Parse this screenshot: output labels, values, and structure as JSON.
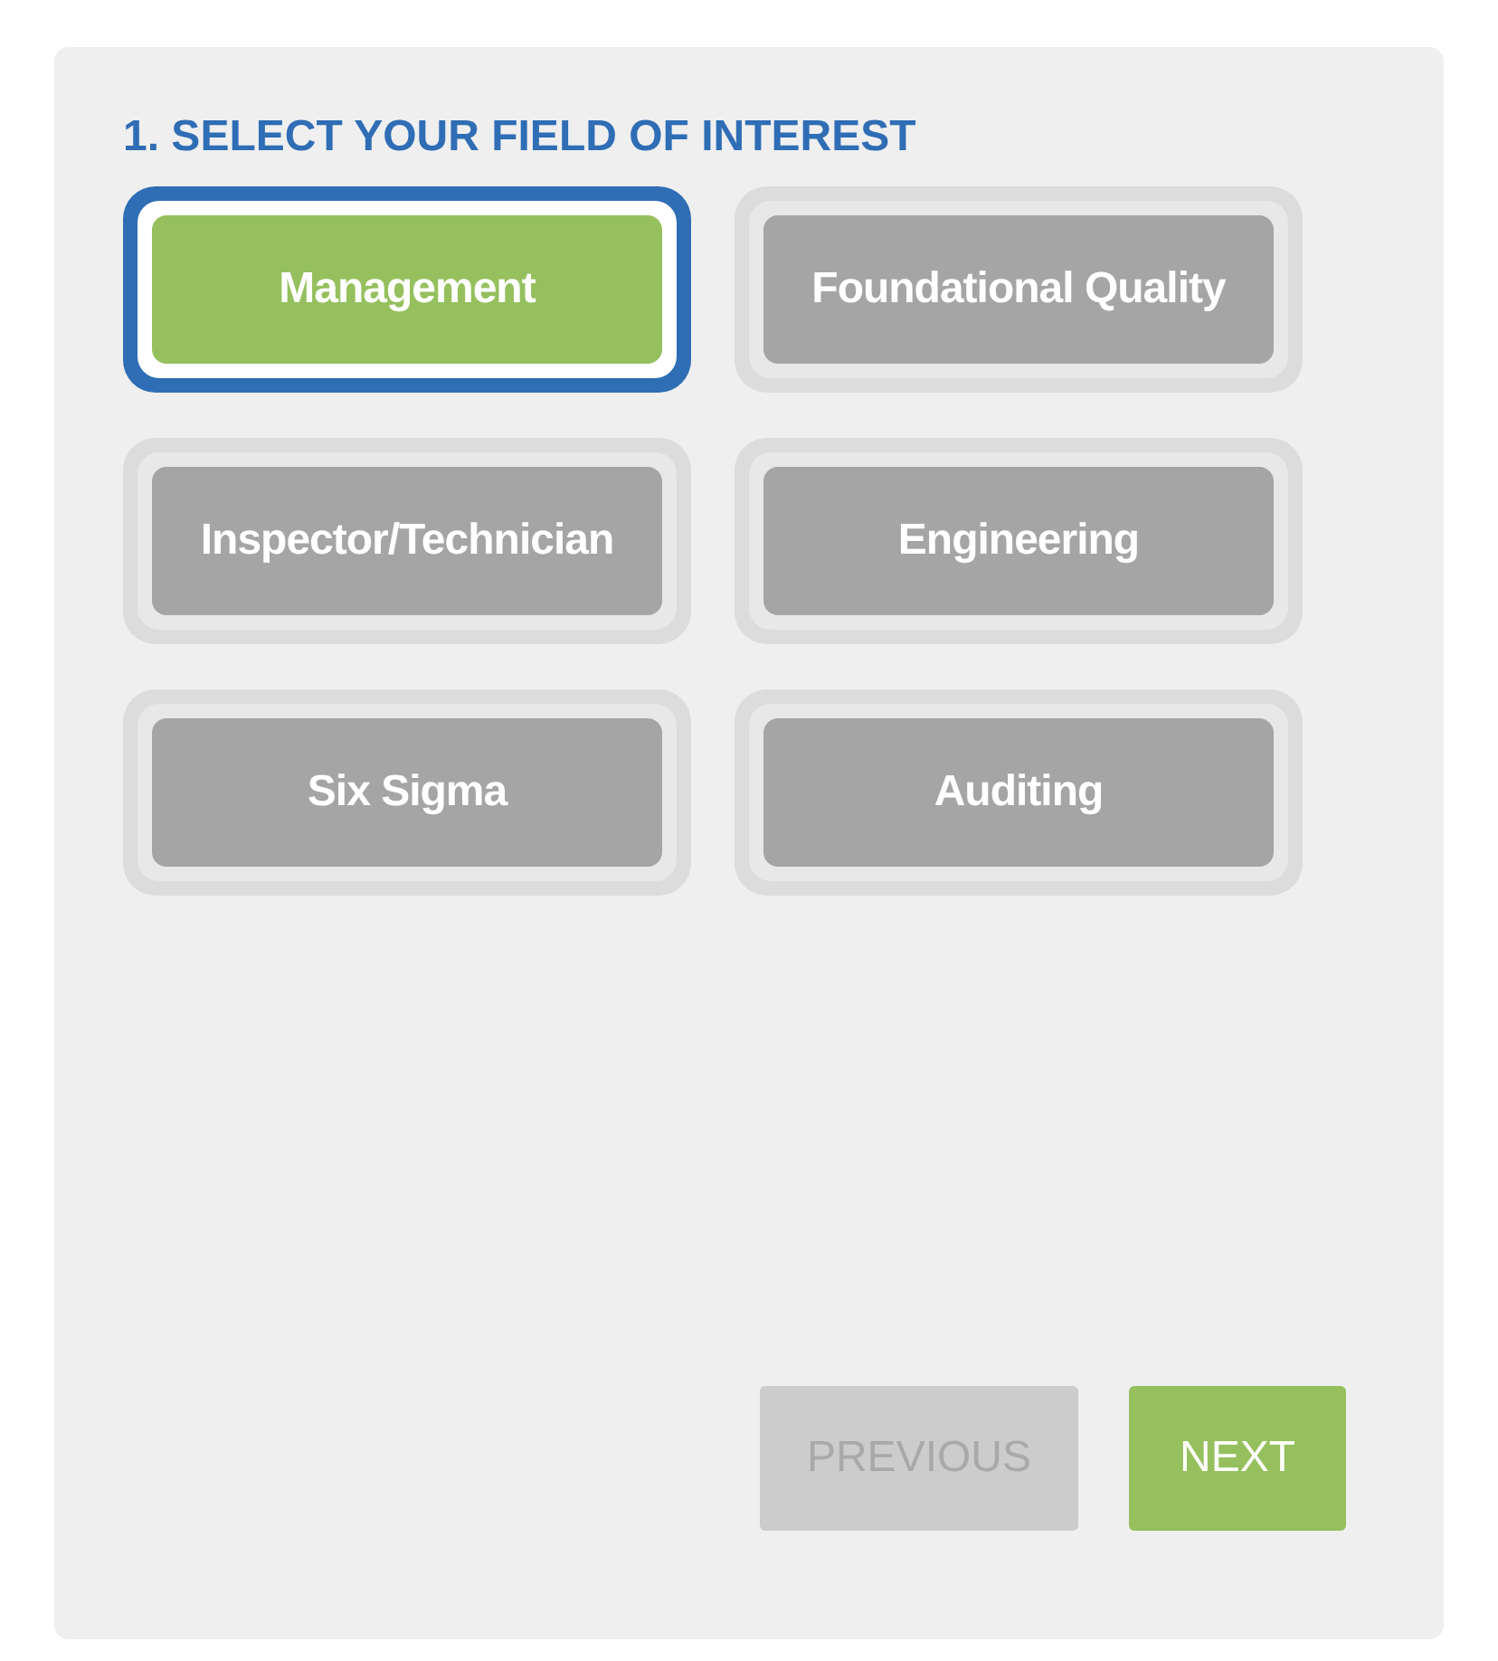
{
  "title": "1. SELECT YOUR FIELD OF INTEREST",
  "fields": [
    {
      "label": "Management",
      "selected": true
    },
    {
      "label": "Foundational Quality",
      "selected": false
    },
    {
      "label": "Inspector/Technician",
      "selected": false
    },
    {
      "label": "Engineering",
      "selected": false
    },
    {
      "label": "Six Sigma",
      "selected": false
    },
    {
      "label": "Auditing",
      "selected": false
    }
  ],
  "nav": [
    {
      "label": "PREVIOUS",
      "disabled": true
    },
    {
      "label": "NEXT",
      "disabled": false
    }
  ]
}
